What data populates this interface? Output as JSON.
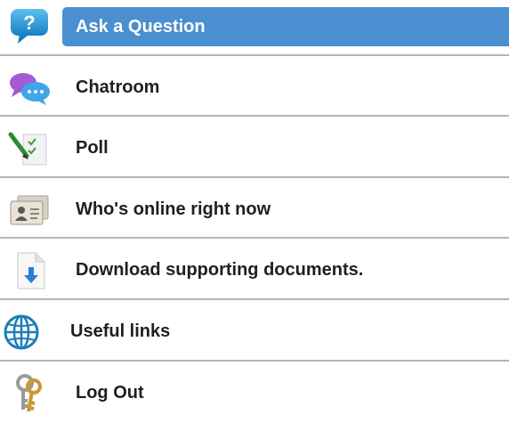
{
  "menu": {
    "items": [
      {
        "id": "ask",
        "label": "Ask a Question",
        "icon": "question-bubble-icon",
        "active": true
      },
      {
        "id": "chat",
        "label": "Chatroom",
        "icon": "chat-bubbles-icon"
      },
      {
        "id": "poll",
        "label": "Poll",
        "icon": "poll-checklist-icon"
      },
      {
        "id": "online",
        "label": "Who's online right now",
        "icon": "contact-cards-icon"
      },
      {
        "id": "download",
        "label": "Download supporting documents.",
        "icon": "download-document-icon"
      },
      {
        "id": "links",
        "label": "Useful links",
        "icon": "globe-icon"
      },
      {
        "id": "logout",
        "label": "Log Out",
        "icon": "keys-icon"
      }
    ]
  },
  "colors": {
    "active_bg": "#4a8fd0",
    "divider": "#b4b4b4",
    "text": "#1f1f1f"
  }
}
